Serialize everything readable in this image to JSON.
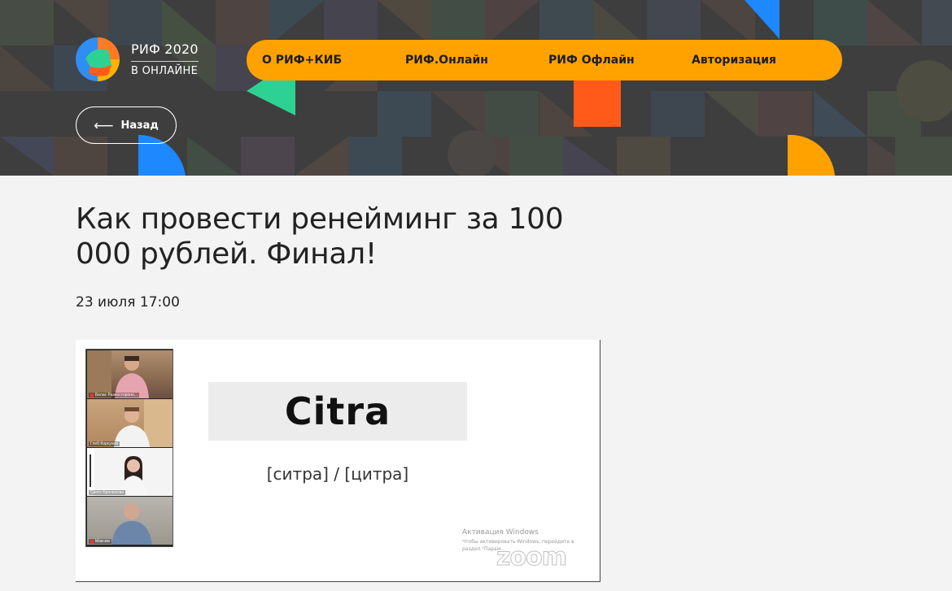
{
  "logo": {
    "line1": "РИФ 2020",
    "line2": "В ОНЛАЙНЕ"
  },
  "nav": {
    "items": [
      {
        "label": "О РИФ+КИБ"
      },
      {
        "label": "РИФ.Онлайн"
      },
      {
        "label": "РИФ Офлайн"
      },
      {
        "label": "Авторизация"
      }
    ]
  },
  "back_button": {
    "arrow": "⟵",
    "label": "Назад"
  },
  "event": {
    "title": "Как провести ренейминг за 100 000 рублей. Финал!",
    "datetime": "23 июля 17:00"
  },
  "video": {
    "slide_word": "Citra",
    "slide_pronunciation": "[ситра] / [цитра]",
    "participants": [
      {
        "name": "Белас Разносторонн..."
      },
      {
        "name": "Глеб Корсунов"
      },
      {
        "name": "Свята Бронюкова"
      },
      {
        "name": "Максим"
      }
    ],
    "windows_watermark": {
      "title": "Активация Windows",
      "subtitle": "Чтобы активировать Windows, перейдите в раздел \"Парам..."
    },
    "app_watermark": "zoom"
  },
  "colors": {
    "nav_bg": "#ffa200",
    "hero_bg": "#3e3e3e",
    "page_bg": "#f3f3f3"
  }
}
